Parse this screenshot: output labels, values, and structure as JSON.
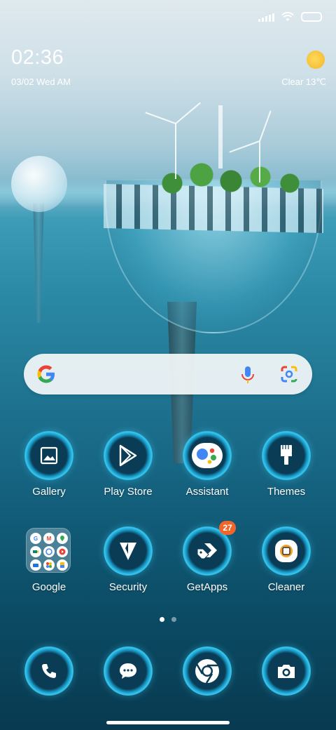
{
  "status_bar": {
    "signal_icon": "cellular-signal-icon",
    "wifi_icon": "wifi-icon",
    "battery_icon": "battery-icon"
  },
  "clock_widget": {
    "time": "02:36",
    "date": "03/02 Wed AM",
    "weather_icon": "sun-icon",
    "weather": "Clear 13℃"
  },
  "search_bar": {
    "logo": "google-g-icon",
    "mic": "microphone-icon",
    "lens": "google-lens-icon"
  },
  "apps_row1": [
    {
      "label": "Gallery",
      "icon": "gallery-icon"
    },
    {
      "label": "Play Store",
      "icon": "play-store-icon"
    },
    {
      "label": "Assistant",
      "icon": "assistant-icon"
    },
    {
      "label": "Themes",
      "icon": "themes-brush-icon"
    }
  ],
  "apps_row2": [
    {
      "label": "Google",
      "icon": "google-folder-icon",
      "folder_items": [
        "G",
        "M",
        "",
        "",
        "",
        "",
        "",
        "",
        ""
      ]
    },
    {
      "label": "Security",
      "icon": "security-shield-icon"
    },
    {
      "label": "GetApps",
      "icon": "getapps-icon",
      "badge": "27"
    },
    {
      "label": "Cleaner",
      "icon": "cleaner-icon"
    }
  ],
  "page_indicator": {
    "pages": 2,
    "current": 1
  },
  "dock": [
    {
      "icon": "phone-icon"
    },
    {
      "icon": "messages-icon"
    },
    {
      "icon": "chrome-icon"
    },
    {
      "icon": "camera-icon"
    }
  ],
  "colors": {
    "badge": "#f2652a",
    "icon_ring": "#36c7ef"
  }
}
